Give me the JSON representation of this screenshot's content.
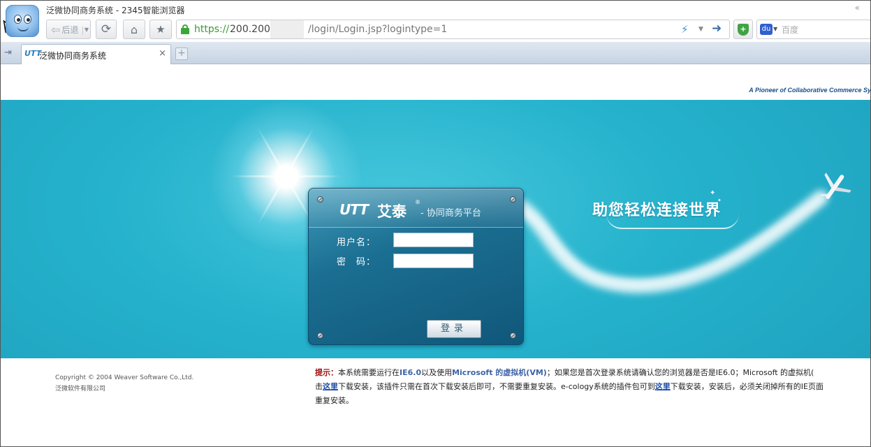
{
  "window": {
    "page_title": "泛微协同商务系统",
    "separator": " - ",
    "browser_name": "2345智能浏览器",
    "collapse_glyph": "«"
  },
  "toolbar": {
    "back_label": "后退",
    "url_scheme": "https://",
    "url_host": "200.200",
    "url_path": "/login/Login.jsp?logintype=1",
    "search_placeholder": "百度"
  },
  "tabs": [
    {
      "favicon_text": "UTT",
      "label": "泛微协同商务系统",
      "close": "×"
    }
  ],
  "new_tab_glyph": "+",
  "page": {
    "tagline": "A Pioneer of Collaborative Commerce Sy",
    "slogan": "助您轻松连接世界",
    "login": {
      "brand_latin": "UTT",
      "brand_cn": "艾泰",
      "brand_reg": "®",
      "brand_sub": "- 协同商务平台",
      "username_label": "用户名：",
      "password_label": "密　码：",
      "username_value": "",
      "password_value": "",
      "submit_label": "登录"
    },
    "footer": {
      "copyright": "Copyright © 2004 Weaver Software Co.,Ltd.",
      "company": "泛微软件有限公司",
      "notice": {
        "hint": "提示：",
        "t1": "本系统需要运行在",
        "ie": "IE6.0",
        "t2": "以及使用",
        "vm": "Microsoft 的虚拟机(VM)",
        "t3": "；如果您是首次登录系统请确认您的浏览器是否是IE6.0；Microsoft 的虚拟机(",
        "t4": "击",
        "link1": "这里",
        "t5": "下载安装，该插件只需在首次下载安装后即可，不需要重复安装。e-cology系统的插件包可到",
        "link2": "这里",
        "t6": "下载安装，安装后，必须关闭掉所有的IE页面",
        "t7": "重复安装。"
      }
    }
  },
  "colors": {
    "banner": "#25b2cc",
    "panel": "#1b6f92",
    "url_green": "#3c9a36",
    "hint_red": "#a01010",
    "link_blue": "#1c4aa6"
  },
  "icons": [
    "app-logo-icon",
    "back-arrow-icon",
    "refresh-icon",
    "home-icon",
    "star-icon",
    "lock-icon",
    "bolt-icon",
    "go-arrow-icon",
    "shield-icon",
    "baidu-paw-icon",
    "close-icon",
    "plus-icon",
    "airplane-icon",
    "mouse-cursor-icon"
  ]
}
